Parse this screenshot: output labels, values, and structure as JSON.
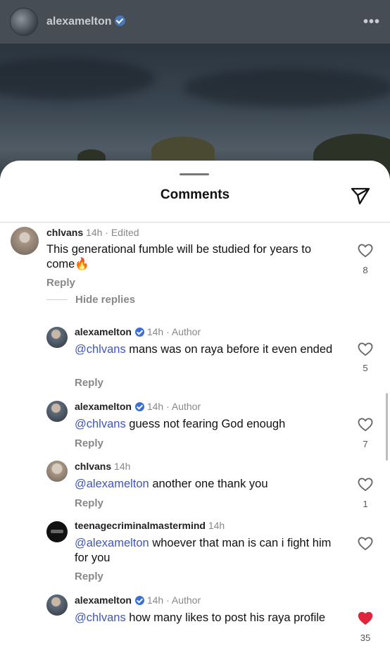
{
  "header": {
    "username": "alexamelton",
    "more_icon": "more-dots-icon"
  },
  "sheet": {
    "title": "Comments",
    "share_icon": "send-icon"
  },
  "thread": {
    "hide_replies": "Hide replies"
  },
  "comments": [
    {
      "user": "chlvans",
      "meta": "14h · Edited",
      "text": "This generational fumble will be studied for years to come🔥",
      "reply": "Reply",
      "likes": "8",
      "liked": false
    },
    {
      "user": "alexamelton",
      "meta": "14h · Author",
      "mention": "@chlvans",
      "text": " mans was on raya before it even ended",
      "reply": "Reply",
      "likes": "5",
      "liked": false
    },
    {
      "user": "alexamelton",
      "meta": "14h · Author",
      "mention": "@chlvans",
      "text": " guess not fearing God enough",
      "reply": "Reply",
      "likes": "7",
      "liked": false
    },
    {
      "user": "chlvans",
      "meta": "14h",
      "mention": "@alexamelton",
      "text": " another one thank you",
      "reply": "Reply",
      "likes": "1",
      "liked": false
    },
    {
      "user": "teenagecriminalmastermind",
      "meta": "14h",
      "mention": "@alexamelton",
      "text": " whoever that man is can i fight him for you",
      "reply": "Reply",
      "likes": "",
      "liked": false
    },
    {
      "user": "alexamelton",
      "meta": "14h · Author",
      "mention": "@chlvans",
      "text": " how many likes to post his raya profile",
      "reply": "",
      "likes": "35",
      "liked": true
    }
  ],
  "colors": {
    "mention": "#3f56b8",
    "liked": "#e0243b",
    "verified": "#3b6fd8"
  }
}
